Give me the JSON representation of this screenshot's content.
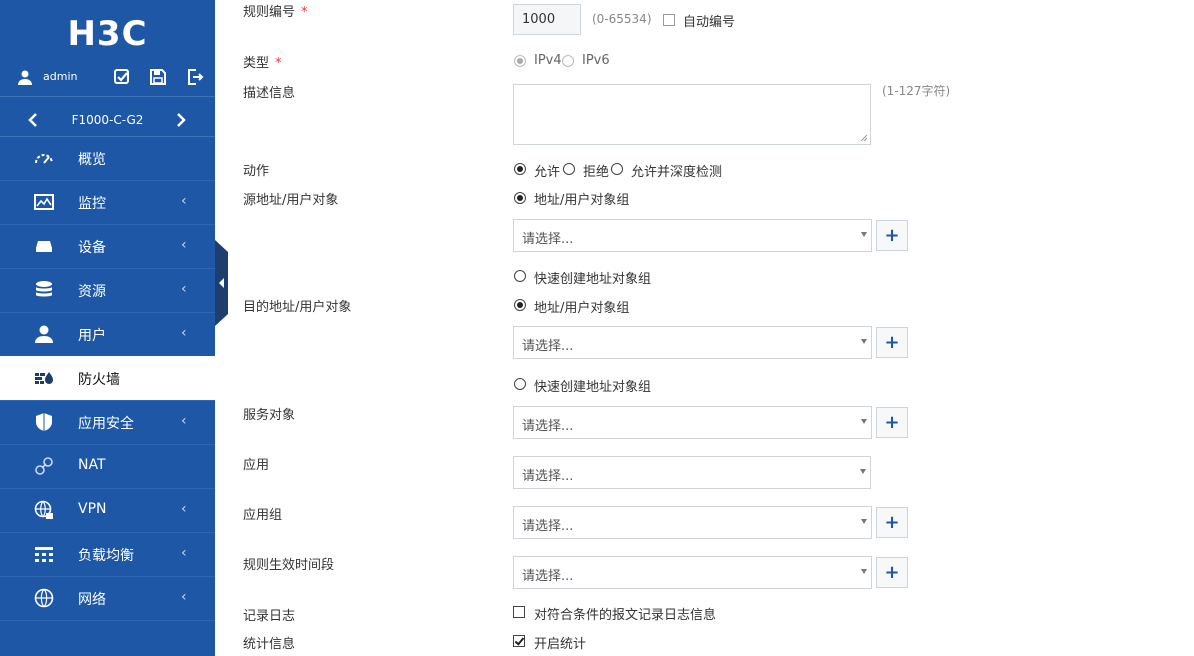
{
  "app": {
    "logo": "H3C",
    "user": "admin",
    "device": "F1000-C-G2"
  },
  "sidebar": {
    "items": [
      {
        "label": "概览",
        "icon": "gauge-icon",
        "expandable": false
      },
      {
        "label": "监控",
        "icon": "monitor-chart-icon",
        "expandable": true
      },
      {
        "label": "设备",
        "icon": "device-icon",
        "expandable": true
      },
      {
        "label": "资源",
        "icon": "database-icon",
        "expandable": true
      },
      {
        "label": "用户",
        "icon": "user-icon",
        "expandable": true
      },
      {
        "label": "防火墙",
        "icon": "firewall-icon",
        "expandable": false,
        "active": true
      },
      {
        "label": "应用安全",
        "icon": "shield-icon",
        "expandable": true
      },
      {
        "label": "NAT",
        "icon": "nat-link-icon",
        "expandable": false
      },
      {
        "label": "VPN",
        "icon": "globe-lock-icon",
        "expandable": true
      },
      {
        "label": "负载均衡",
        "icon": "load-balance-icon",
        "expandable": true
      },
      {
        "label": "网络",
        "icon": "globe-icon",
        "expandable": true
      }
    ],
    "chevron": "‹"
  },
  "form": {
    "rule_id": {
      "label": "规则编号",
      "required": "*",
      "value": "1000",
      "range": "(0-65534)",
      "auto_label": "自动编号"
    },
    "type": {
      "label": "类型",
      "required": "*",
      "opt1": "IPv4",
      "opt2": "IPv6"
    },
    "desc": {
      "label": "描述信息",
      "hint": "(1-127字符)"
    },
    "action": {
      "label": "动作",
      "opt1": "允许",
      "opt2": "拒绝",
      "opt3": "允许并深度检测"
    },
    "src": {
      "label": "源地址/用户对象",
      "opt_group": "地址/用户对象组",
      "placeholder": "请选择...",
      "opt_quick": "快速创建地址对象组"
    },
    "dst": {
      "label": "目的地址/用户对象",
      "opt_group": "地址/用户对象组",
      "placeholder": "请选择...",
      "opt_quick": "快速创建地址对象组"
    },
    "service": {
      "label": "服务对象",
      "placeholder": "请选择..."
    },
    "app": {
      "label": "应用",
      "placeholder": "请选择..."
    },
    "app_group": {
      "label": "应用组",
      "placeholder": "请选择..."
    },
    "time_range": {
      "label": "规则生效时间段",
      "placeholder": "请选择..."
    },
    "log": {
      "label": "记录日志",
      "option": "对符合条件的报文记录日志信息"
    },
    "stats": {
      "label": "统计信息",
      "option": "开启统计"
    },
    "plus": "+"
  }
}
